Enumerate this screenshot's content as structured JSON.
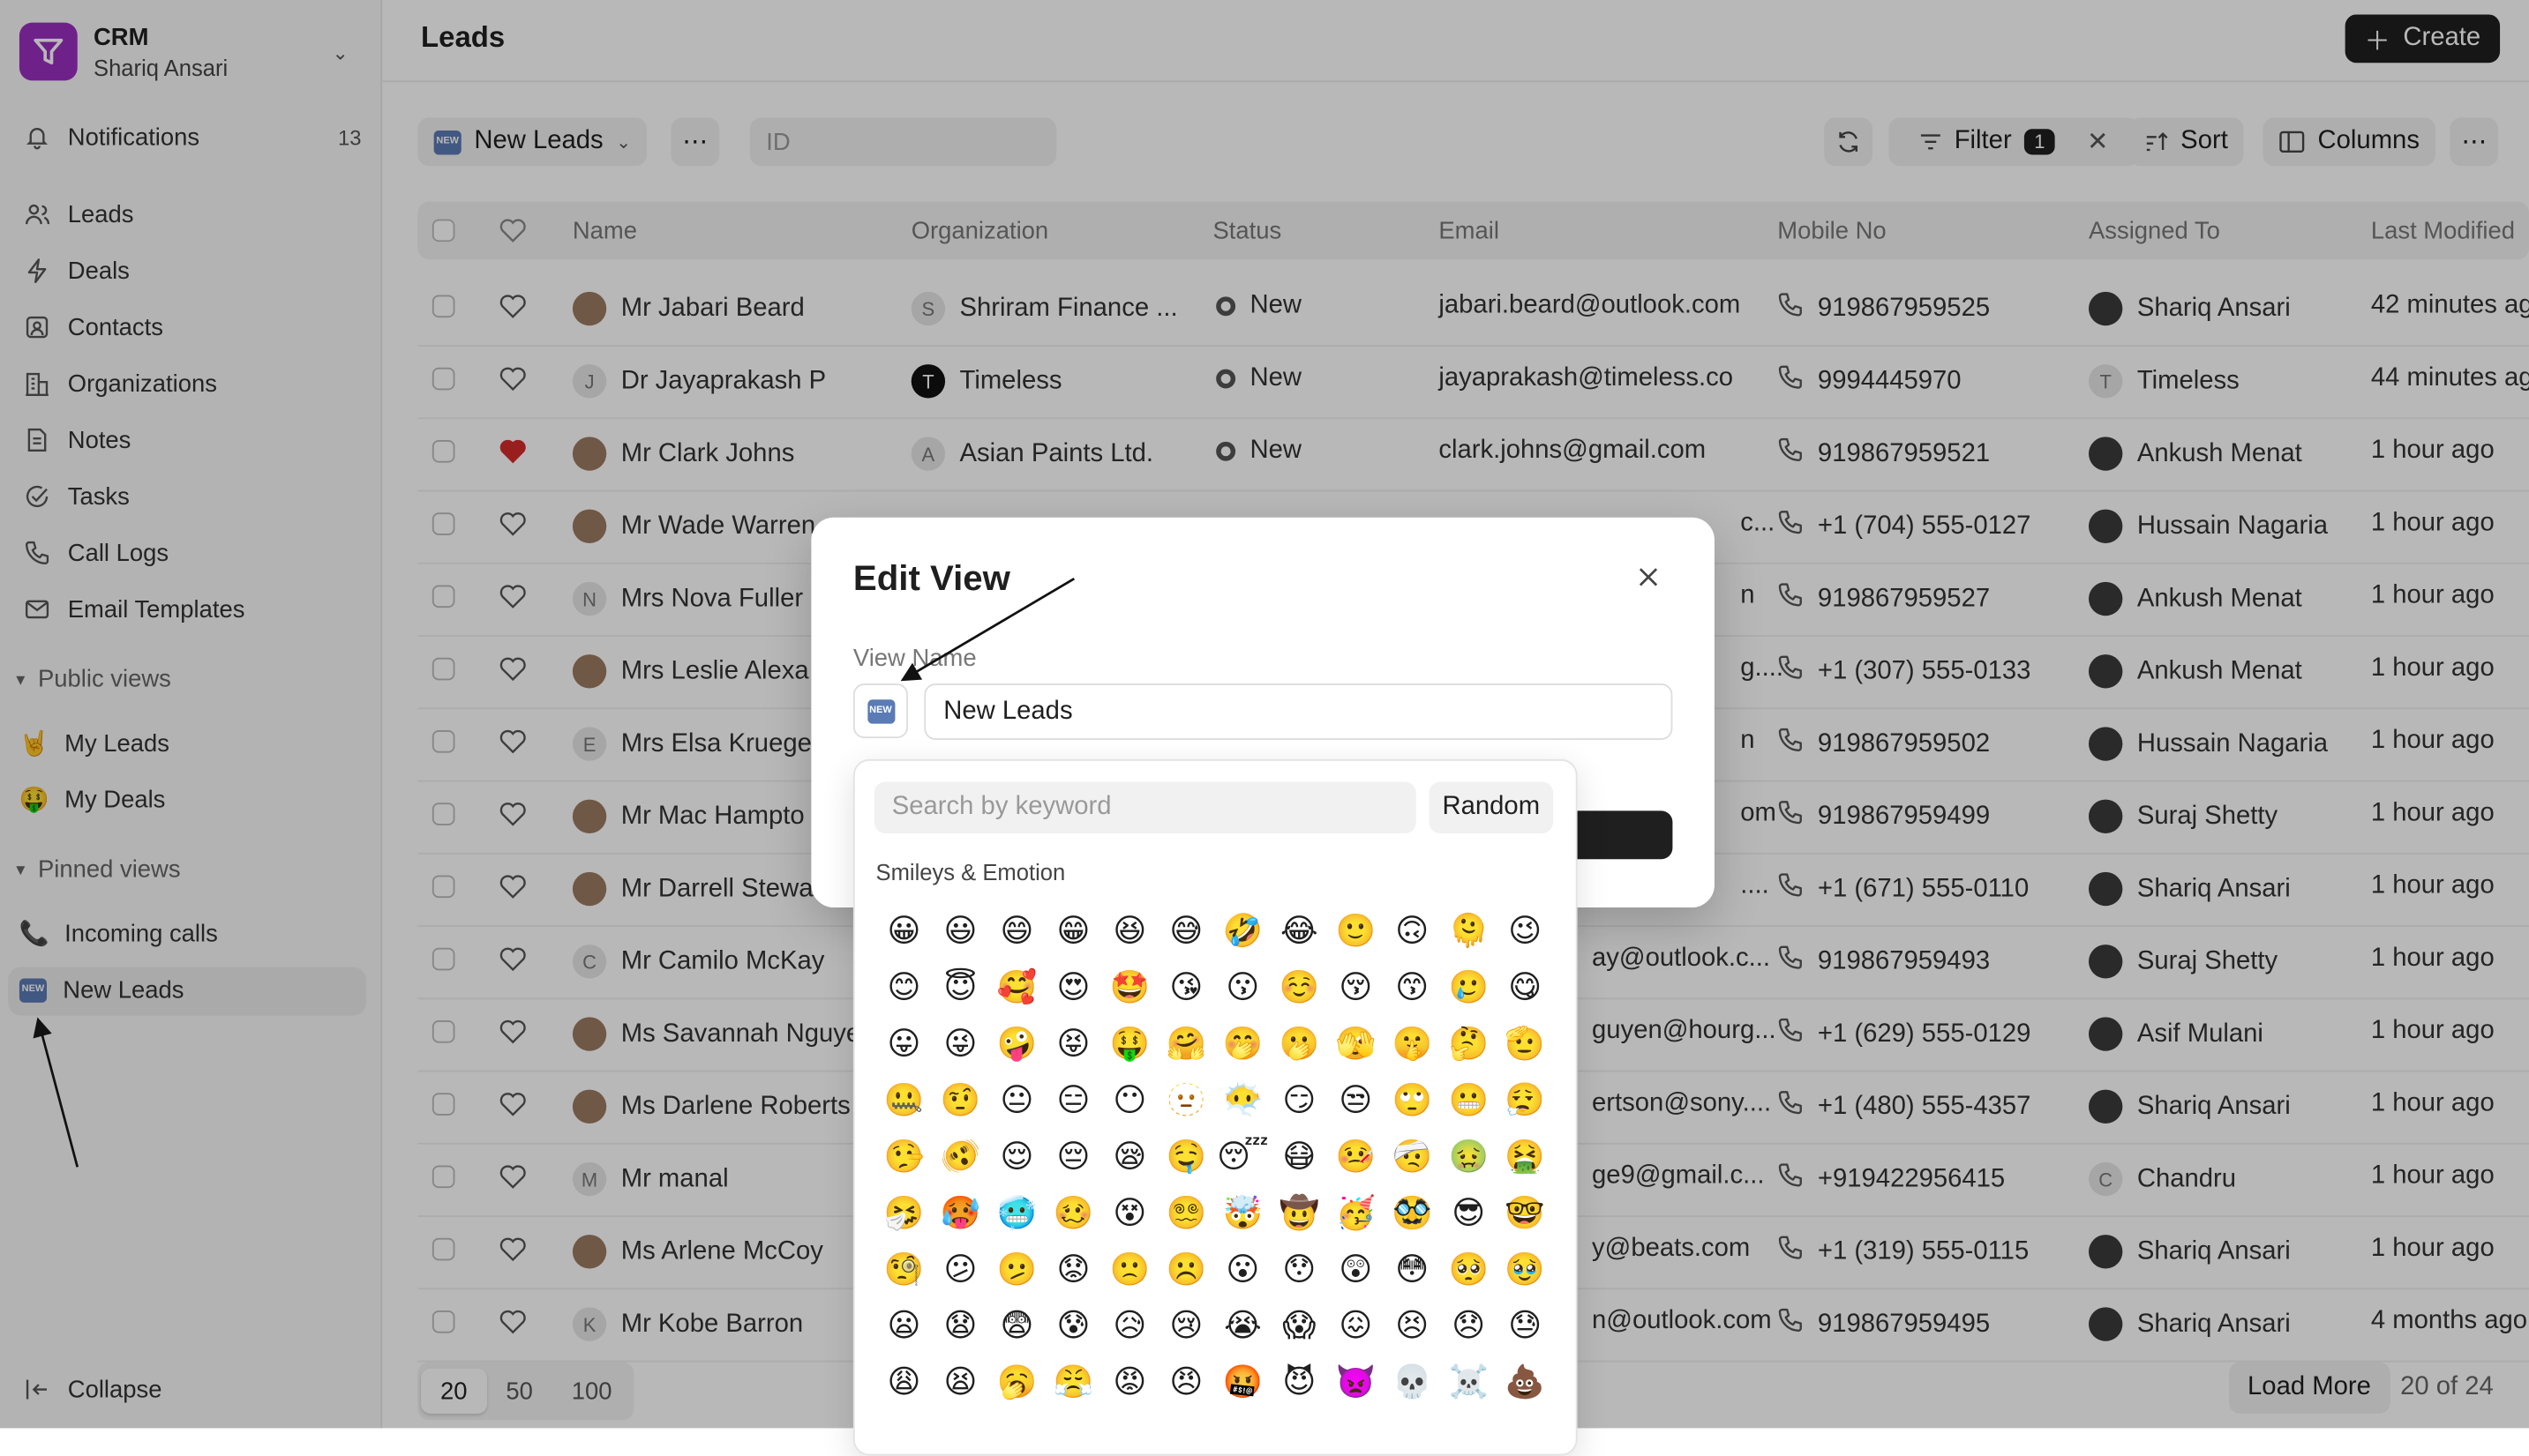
{
  "app": {
    "name": "CRM",
    "user": "Shariq Ansari"
  },
  "sidebar": {
    "notifications": {
      "label": "Notifications",
      "count": "13"
    },
    "items": [
      {
        "label": "Leads"
      },
      {
        "label": "Deals"
      },
      {
        "label": "Contacts"
      },
      {
        "label": "Organizations"
      },
      {
        "label": "Notes"
      },
      {
        "label": "Tasks"
      },
      {
        "label": "Call Logs"
      },
      {
        "label": "Email Templates"
      }
    ],
    "public_views": {
      "label": "Public views",
      "items": [
        {
          "emoji": "🤘",
          "label": "My Leads"
        },
        {
          "emoji": "🤑",
          "label": "My Deals"
        }
      ]
    },
    "pinned_views": {
      "label": "Pinned views",
      "items": [
        {
          "label": "Incoming calls"
        },
        {
          "label": "New Leads"
        }
      ]
    },
    "collapse": "Collapse"
  },
  "header": {
    "title": "Leads",
    "create": "Create"
  },
  "toolbar": {
    "view": "New Leads",
    "id_placeholder": "ID",
    "filter": "Filter",
    "filter_count": "1",
    "sort": "Sort",
    "columns": "Columns"
  },
  "table": {
    "columns": [
      "Name",
      "Organization",
      "Status",
      "Email",
      "Mobile No",
      "Assigned To",
      "Last Modified"
    ],
    "rows": [
      {
        "name": "Mr Jabari Beard",
        "org": "Shriram Finance ...",
        "org_i": "S",
        "status": "New",
        "email": "jabari.beard@outlook.com",
        "mobile": "919867959525",
        "assigned": "Shariq Ansari",
        "modified": "42 minutes ag"
      },
      {
        "name": "Dr Jayaprakash P",
        "org": "Timeless",
        "org_i": "T",
        "status": "New",
        "email": "jayaprakash@timeless.co",
        "mobile": "9994445970",
        "assigned": "Timeless",
        "modified": "44 minutes ag",
        "ini": "J"
      },
      {
        "name": "Mr Clark Johns",
        "org": "Asian Paints Ltd.",
        "org_i": "A",
        "status": "New",
        "email": "clark.johns@gmail.com",
        "mobile": "919867959521",
        "assigned": "Ankush Menat",
        "modified": "1 hour ago",
        "liked": true
      },
      {
        "name": "Mr Wade Warren",
        "email": "c...",
        "mobile": "+1 (704) 555-0127",
        "assigned": "Hussain Nagaria",
        "modified": "1 hour ago"
      },
      {
        "name": "Mrs Nova Fuller",
        "email": "n",
        "mobile": "919867959527",
        "assigned": "Ankush Menat",
        "modified": "1 hour ago",
        "ini": "N"
      },
      {
        "name": "Mrs Leslie Alexa",
        "email": "g....",
        "mobile": "+1 (307) 555-0133",
        "assigned": "Ankush Menat",
        "modified": "1 hour ago"
      },
      {
        "name": "Mrs Elsa Kruege",
        "email": "n",
        "mobile": "919867959502",
        "assigned": "Hussain Nagaria",
        "modified": "1 hour ago",
        "ini": "E"
      },
      {
        "name": "Mr Mac Hampto",
        "email": "om",
        "mobile": "919867959499",
        "assigned": "Suraj Shetty",
        "modified": "1 hour ago"
      },
      {
        "name": "Mr Darrell Stewa",
        "email": "....",
        "mobile": "+1 (671) 555-0110",
        "assigned": "Shariq Ansari",
        "modified": "1 hour ago"
      },
      {
        "name": "Mr Camilo McKay",
        "email": "ay@outlook.c...",
        "mobile": "919867959493",
        "assigned": "Suraj Shetty",
        "modified": "1 hour ago",
        "ini": "C"
      },
      {
        "name": "Ms Savannah Nguye",
        "email": "guyen@hourg...",
        "mobile": "+1 (629) 555-0129",
        "assigned": "Asif Mulani",
        "modified": "1 hour ago"
      },
      {
        "name": "Ms Darlene Roberts",
        "email": "ertson@sony....",
        "mobile": "+1 (480) 555-4357",
        "assigned": "Shariq Ansari",
        "modified": "1 hour ago"
      },
      {
        "name": "Mr manal",
        "email": "ge9@gmail.c...",
        "mobile": "+919422956415",
        "assigned": "Chandru",
        "modified": "1 hour ago",
        "ini": "M",
        "as_i": "C"
      },
      {
        "name": "Ms Arlene McCoy",
        "email": "y@beats.com",
        "mobile": "+1 (319) 555-0115",
        "assigned": "Shariq Ansari",
        "modified": "1 hour ago"
      },
      {
        "name": "Mr Kobe Barron",
        "email": "n@outlook.com",
        "mobile": "919867959495",
        "assigned": "Shariq Ansari",
        "modified": "4 months ago",
        "ini": "K"
      }
    ]
  },
  "footer": {
    "sizes": [
      "20",
      "50",
      "100"
    ],
    "load_more": "Load More",
    "total": "20 of 24"
  },
  "modal": {
    "title": "Edit View",
    "view_name_label": "View Name",
    "view_name_value": "New Leads",
    "picker": {
      "search_placeholder": "Search by keyword",
      "random": "Random",
      "category": "Smileys & Emotion",
      "emojis": [
        "😀",
        "😃",
        "😄",
        "😁",
        "😆",
        "😅",
        "🤣",
        "😂",
        "🙂",
        "🙃",
        "🫠",
        "😉",
        "😊",
        "😇",
        "🥰",
        "😍",
        "🤩",
        "😘",
        "😗",
        "☺️",
        "😚",
        "😙",
        "🥲",
        "😋",
        "😛",
        "😜",
        "🤪",
        "😝",
        "🤑",
        "🤗",
        "🤭",
        "🫢",
        "🫣",
        "🤫",
        "🤔",
        "🫡",
        "🤐",
        "🤨",
        "😐",
        "😑",
        "😶",
        "🫥",
        "😶‍🌫️",
        "😏",
        "😒",
        "🙄",
        "😬",
        "😮‍💨",
        "🤥",
        "🫨",
        "😌",
        "😔",
        "😪",
        "🤤",
        "😴",
        "😷",
        "🤒",
        "🤕",
        "🤢",
        "🤮",
        "🤧",
        "🥵",
        "🥶",
        "🥴",
        "😵",
        "😵‍💫",
        "🤯",
        "🤠",
        "🥳",
        "🥸",
        "😎",
        "🤓",
        "🧐",
        "😕",
        "🫤",
        "😟",
        "🙁",
        "☹️",
        "😮",
        "😯",
        "😲",
        "😳",
        "🥺",
        "🥹",
        "😦",
        "😧",
        "😨",
        "😰",
        "😥",
        "😢",
        "😭",
        "😱",
        "😖",
        "😣",
        "😞",
        "😓",
        "😩",
        "😫",
        "🥱",
        "😤",
        "😡",
        "😠",
        "🤬",
        "😈",
        "👿",
        "💀",
        "☠️",
        "💩"
      ]
    }
  }
}
